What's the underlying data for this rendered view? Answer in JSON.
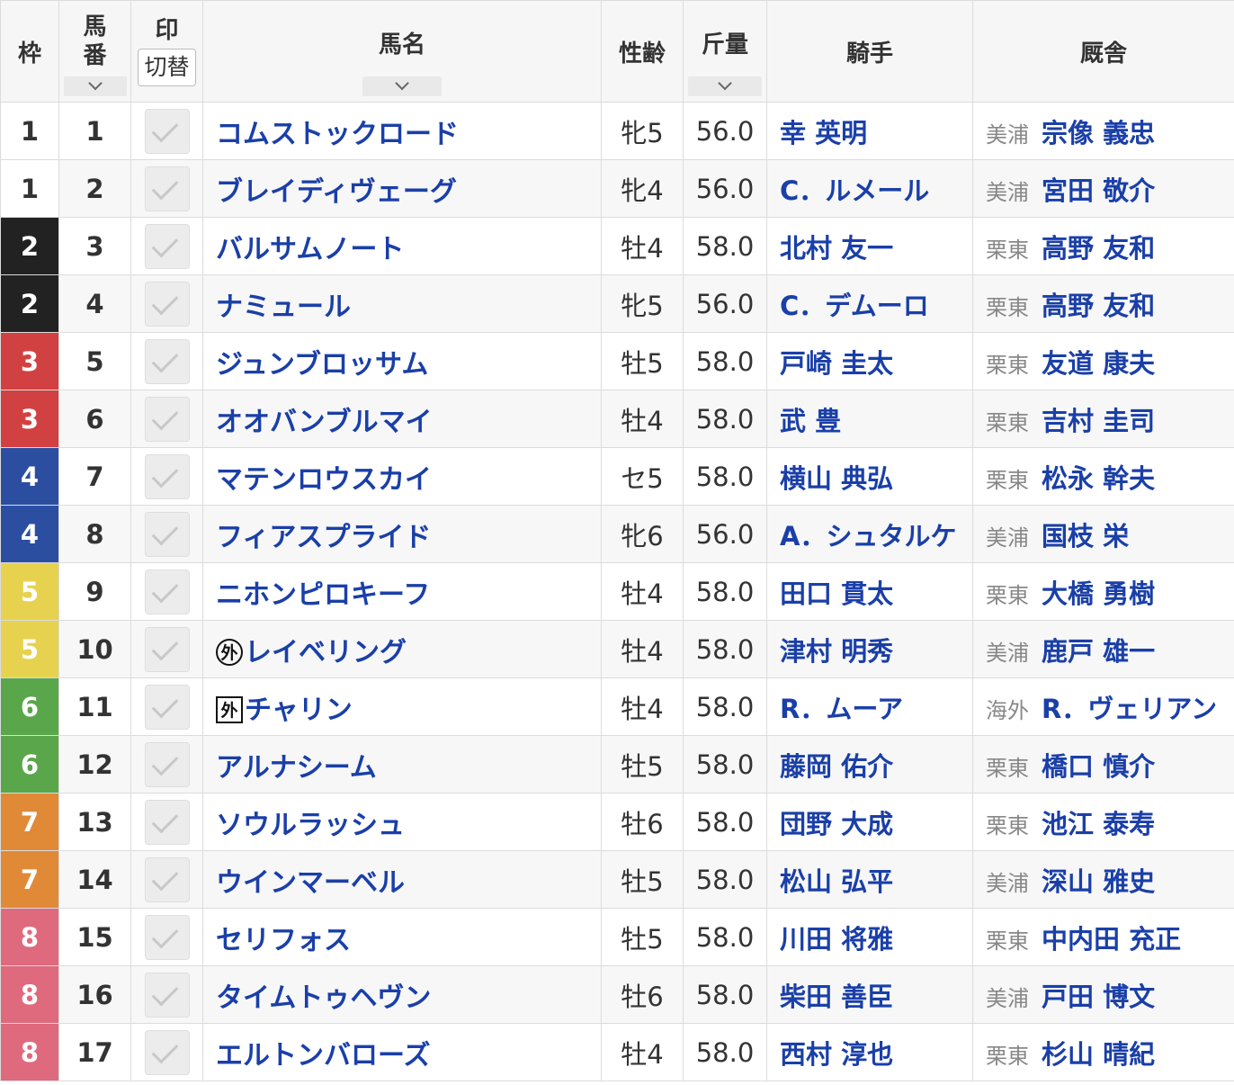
{
  "header": {
    "waku": "枠",
    "umaban": "馬番",
    "mark": "印",
    "mark_toggle": "切替",
    "name": "馬名",
    "sexage": "性齢",
    "weight": "斤量",
    "jockey": "騎手",
    "trainer": "厩舎"
  },
  "colors": {
    "waku": {
      "1": {
        "bg": "#ffffff",
        "fg": "#333333"
      },
      "2": {
        "bg": "#222222",
        "fg": "#ffffff"
      },
      "3": {
        "bg": "#d24141",
        "fg": "#ffffff"
      },
      "4": {
        "bg": "#2c4ea0",
        "fg": "#ffffff"
      },
      "5": {
        "bg": "#e6d24e",
        "fg": "#ffffff"
      },
      "6": {
        "bg": "#5aa64b",
        "fg": "#ffffff"
      },
      "7": {
        "bg": "#e08a38",
        "fg": "#ffffff"
      },
      "8": {
        "bg": "#df6a7e",
        "fg": "#ffffff"
      }
    }
  },
  "rows": [
    {
      "waku": "1",
      "umaban": "1",
      "badge": "",
      "name": "コムストックロード",
      "sexage": "牝5",
      "weight": "56.0",
      "jockey": "幸 英明",
      "loc": "美浦",
      "trainer": "宗像 義忠"
    },
    {
      "waku": "1",
      "umaban": "2",
      "badge": "",
      "name": "ブレイディヴェーグ",
      "sexage": "牝4",
      "weight": "56.0",
      "jockey": "C．ルメール",
      "loc": "美浦",
      "trainer": "宮田 敬介"
    },
    {
      "waku": "2",
      "umaban": "3",
      "badge": "",
      "name": "バルサムノート",
      "sexage": "牡4",
      "weight": "58.0",
      "jockey": "北村 友一",
      "loc": "栗東",
      "trainer": "高野 友和"
    },
    {
      "waku": "2",
      "umaban": "4",
      "badge": "",
      "name": "ナミュール",
      "sexage": "牝5",
      "weight": "56.0",
      "jockey": "C．デムーロ",
      "loc": "栗東",
      "trainer": "高野 友和"
    },
    {
      "waku": "3",
      "umaban": "5",
      "badge": "",
      "name": "ジュンブロッサム",
      "sexage": "牡5",
      "weight": "58.0",
      "jockey": "戸崎 圭太",
      "loc": "栗東",
      "trainer": "友道 康夫"
    },
    {
      "waku": "3",
      "umaban": "6",
      "badge": "",
      "name": "オオバンブルマイ",
      "sexage": "牡4",
      "weight": "58.0",
      "jockey": "武 豊",
      "loc": "栗東",
      "trainer": "吉村 圭司"
    },
    {
      "waku": "4",
      "umaban": "7",
      "badge": "",
      "name": "マテンロウスカイ",
      "sexage": "セ5",
      "weight": "58.0",
      "jockey": "横山 典弘",
      "loc": "栗東",
      "trainer": "松永 幹夫"
    },
    {
      "waku": "4",
      "umaban": "8",
      "badge": "",
      "name": "フィアスプライド",
      "sexage": "牝6",
      "weight": "56.0",
      "jockey": "A．シュタルケ",
      "loc": "美浦",
      "trainer": "国枝 栄"
    },
    {
      "waku": "5",
      "umaban": "9",
      "badge": "",
      "name": "ニホンピロキーフ",
      "sexage": "牡4",
      "weight": "58.0",
      "jockey": "田口 貫太",
      "loc": "栗東",
      "trainer": "大橋 勇樹"
    },
    {
      "waku": "5",
      "umaban": "10",
      "badge": "外",
      "badge_shape": "circle",
      "name": "レイベリング",
      "sexage": "牡4",
      "weight": "58.0",
      "jockey": "津村 明秀",
      "loc": "美浦",
      "trainer": "鹿戸 雄一"
    },
    {
      "waku": "6",
      "umaban": "11",
      "badge": "外",
      "badge_shape": "square",
      "name": "チャリン",
      "sexage": "牡4",
      "weight": "58.0",
      "jockey": "R．ムーア",
      "loc": "海外",
      "trainer": "R．ヴェリアン"
    },
    {
      "waku": "6",
      "umaban": "12",
      "badge": "",
      "name": "アルナシーム",
      "sexage": "牡5",
      "weight": "58.0",
      "jockey": "藤岡 佑介",
      "loc": "栗東",
      "trainer": "橋口 慎介"
    },
    {
      "waku": "7",
      "umaban": "13",
      "badge": "",
      "name": "ソウルラッシュ",
      "sexage": "牡6",
      "weight": "58.0",
      "jockey": "団野 大成",
      "loc": "栗東",
      "trainer": "池江 泰寿"
    },
    {
      "waku": "7",
      "umaban": "14",
      "badge": "",
      "name": "ウインマーベル",
      "sexage": "牡5",
      "weight": "58.0",
      "jockey": "松山 弘平",
      "loc": "美浦",
      "trainer": "深山 雅史"
    },
    {
      "waku": "8",
      "umaban": "15",
      "badge": "",
      "name": "セリフォス",
      "sexage": "牡5",
      "weight": "58.0",
      "jockey": "川田 将雅",
      "loc": "栗東",
      "trainer": "中内田 充正"
    },
    {
      "waku": "8",
      "umaban": "16",
      "badge": "",
      "name": "タイムトゥヘヴン",
      "sexage": "牡6",
      "weight": "58.0",
      "jockey": "柴田 善臣",
      "loc": "美浦",
      "trainer": "戸田 博文"
    },
    {
      "waku": "8",
      "umaban": "17",
      "badge": "",
      "name": "エルトンバローズ",
      "sexage": "牡4",
      "weight": "58.0",
      "jockey": "西村 淳也",
      "loc": "栗東",
      "trainer": "杉山 晴紀"
    }
  ]
}
